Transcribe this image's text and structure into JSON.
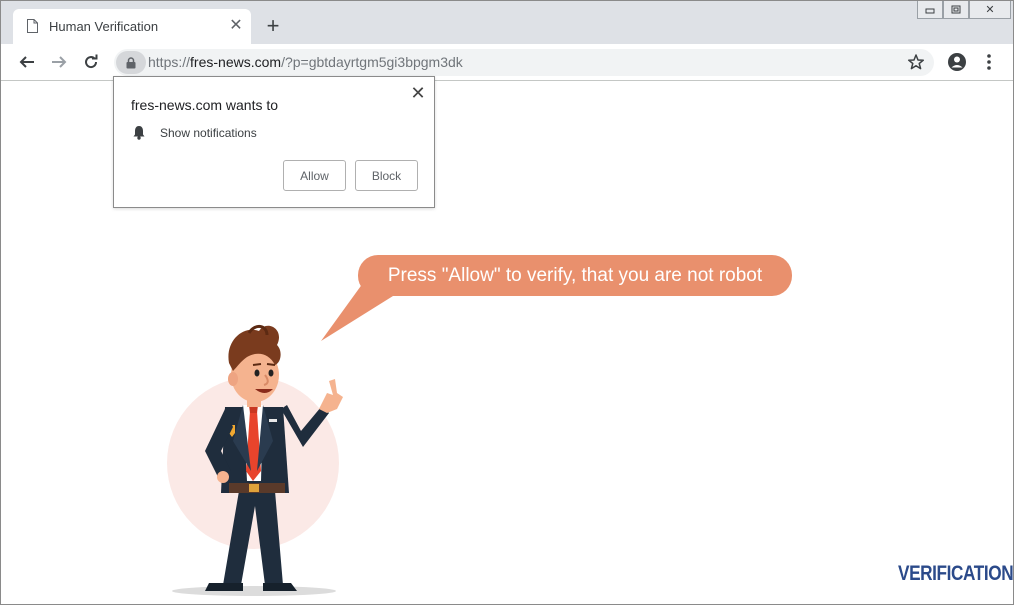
{
  "browser": {
    "tab": {
      "title": "Human Verification",
      "close_glyph": "✕"
    },
    "new_tab_glyph": "+",
    "window_controls": {
      "minimize": "▭",
      "maximize": "⧉",
      "close": "✕"
    },
    "url": {
      "scheme": "https://",
      "host": "fres-news.com",
      "rest": "/?p=gbtdayrtgm5gi3bpgm3dk"
    },
    "icons": [
      "back-arrow-icon",
      "forward-arrow-icon",
      "reload-icon",
      "lock-icon",
      "star-icon",
      "account-icon",
      "menu-icon"
    ]
  },
  "permission_prompt": {
    "title": "fres-news.com wants to",
    "permission": "Show notifications",
    "allow_label": "Allow",
    "block_label": "Block",
    "close_glyph": "✕"
  },
  "page": {
    "bubble_text": "Press \"Allow\" to verify, that you are not robot",
    "logo_text": "VERIFICATION",
    "colors": {
      "bubble": "#e9906d",
      "logo": "#2b4a8a",
      "suit": "#1f2d3d",
      "tie": "#e8442c",
      "hair": "#7a3b1e"
    }
  }
}
